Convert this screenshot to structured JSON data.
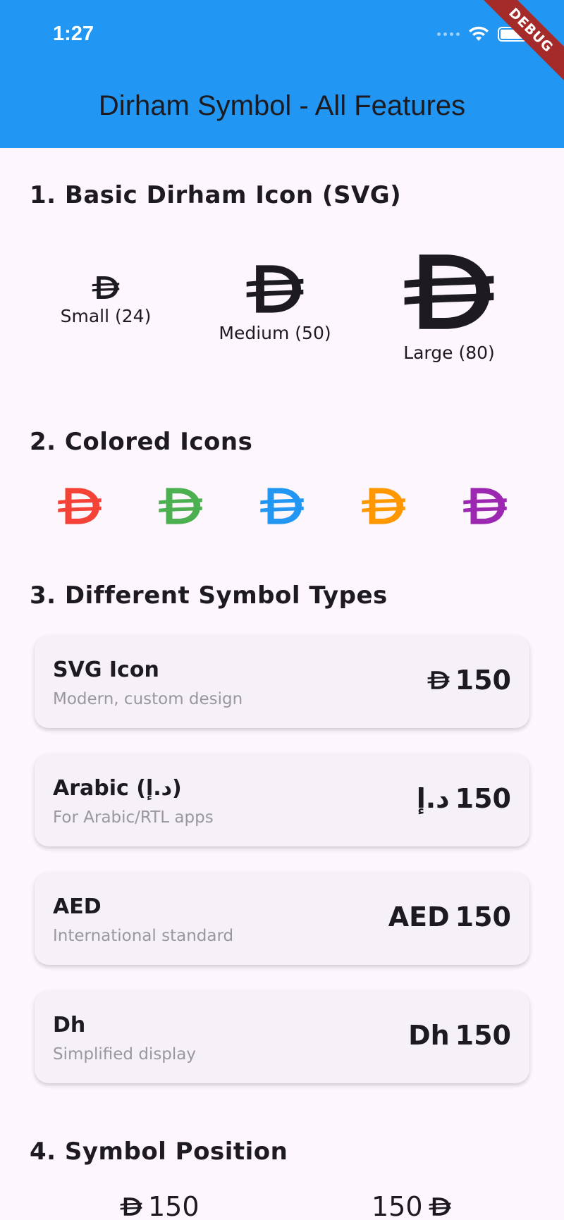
{
  "status_bar": {
    "time": "1:27",
    "icons": [
      "signal-dots-icon",
      "wifi-icon",
      "battery-icon"
    ]
  },
  "debug_banner": "DEBUG",
  "appbar": {
    "title": "Dirham Symbol - All Features",
    "color": "#2196F3"
  },
  "section1": {
    "title": "1. Basic Dirham Icon (SVG)",
    "items": [
      {
        "label": "Small (24)",
        "icon": "dirham-icon"
      },
      {
        "label": "Medium (50)",
        "icon": "dirham-icon"
      },
      {
        "label": "Large (80)",
        "icon": "dirham-icon"
      }
    ]
  },
  "section2": {
    "title": "2. Colored Icons",
    "colors": [
      "#F44336",
      "#4CAF50",
      "#2196F3",
      "#FF9800",
      "#9C27B0"
    ]
  },
  "section3": {
    "title": "3. Different Symbol Types",
    "cards": [
      {
        "title": "SVG Icon",
        "subtitle": "Modern, custom design",
        "symbol": "",
        "amount": "150",
        "icon": "dirham-icon"
      },
      {
        "title": "Arabic (د.إ)",
        "subtitle": "For Arabic/RTL apps",
        "symbol": "د.إ",
        "amount": "150"
      },
      {
        "title": "AED",
        "subtitle": "International standard",
        "symbol": "AED",
        "amount": "150"
      },
      {
        "title": "Dh",
        "subtitle": "Simplified display",
        "symbol": "Dh",
        "amount": "150"
      }
    ]
  },
  "section4": {
    "title": "4. Symbol Position",
    "items": [
      {
        "position": "before",
        "amount": "150"
      },
      {
        "position": "after",
        "amount": "150"
      }
    ]
  }
}
